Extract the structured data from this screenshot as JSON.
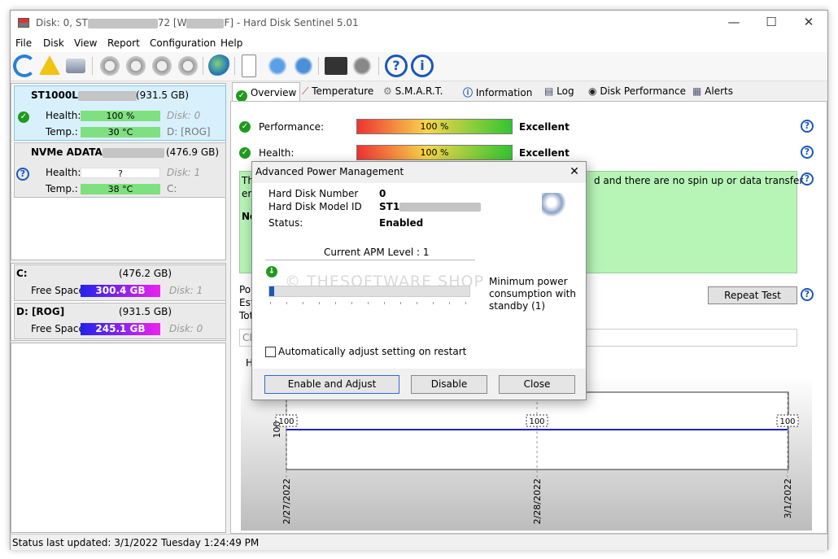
{
  "window": {
    "title_prefix": "Disk: 0, ST",
    "title_mid": "72 [W",
    "title_suffix": "F]  -  Hard Disk Sentinel 5.01",
    "minimize": "—",
    "maximize": "☐",
    "close": "✕"
  },
  "menu": [
    "File",
    "Disk",
    "View",
    "Report",
    "Configuration",
    "Help"
  ],
  "toolbar_icons": [
    "refresh-icon",
    "warning-icon",
    "drive-icon",
    "disk-test-icon",
    "disk-test-2-icon",
    "disk-ok-icon",
    "disk-tools-icon",
    "globe-icon",
    "report-icon",
    "sync-icon",
    "network-icon",
    "monitor-icon",
    "speaker-icon",
    "help-icon",
    "info-icon"
  ],
  "disks": [
    {
      "name": "ST1000L",
      "name_suffix": "(931.5 GB)",
      "health_label": "Health:",
      "health": "100 %",
      "health_part": "Disk: 0",
      "temp_label": "Temp.:",
      "temp": "30 °C",
      "temp_part": "D: [ROG]"
    },
    {
      "name": "NVMe   ADATA",
      "name_suffix": "(476.9 GB)",
      "health_label": "Health:",
      "health": "?",
      "health_part": "Disk: 1",
      "temp_label": "Temp.:",
      "temp": "38 °C",
      "temp_part": "C:"
    }
  ],
  "volumes": [
    {
      "name": "C:",
      "size": "(476.2 GB)",
      "free_label": "Free Space",
      "free": "300.4 GB",
      "disk": "Disk: 1"
    },
    {
      "name": "D: [ROG]",
      "size": "(931.5 GB)",
      "free_label": "Free Space",
      "free": "245.1 GB",
      "disk": "Disk: 0"
    }
  ],
  "tabs": [
    "Overview",
    "Temperature",
    "S.M.A.R.T.",
    "Information",
    "Log",
    "Disk Performance",
    "Alerts"
  ],
  "overview": {
    "performance_label": "Performance:",
    "performance_value": "100 %",
    "performance_text": "Excellent",
    "health_label": "Health:",
    "health_value": "100 %",
    "health_text": "Excellent",
    "status_text_a": "Th",
    "status_text_b": "d and there are no spin up or data transfer",
    "status_text_c": "er",
    "status_text_d": "No",
    "left_labels": [
      "Pow",
      "Est",
      "Tot"
    ],
    "repeat_test": "Repeat Test",
    "comment_placeholder": "Cli",
    "history_label": "H",
    "chart_values": [
      "100",
      "100",
      "100"
    ],
    "chart_dates": [
      "2/27/2022",
      "2/28/2022",
      "3/1/2022"
    ],
    "y_tick": "100"
  },
  "status_bar": "Status last updated: 3/1/2022 Tuesday 1:24:49 PM",
  "dialog": {
    "title": "Advanced Power Management",
    "close": "✕",
    "hdn_label": "Hard Disk Number",
    "hdn_value": "0",
    "model_label": "Hard Disk Model ID",
    "model_value": "ST1",
    "status_label": "Status:",
    "status_value": "Enabled",
    "apm_level": "Current APM Level : 1",
    "level_desc": "Minimum power consumption with standby (1)",
    "auto_adjust": "Automatically adjust setting on restart",
    "enable_btn": "Enable and Adjust",
    "disable_btn": "Disable",
    "close_btn": "Close",
    "watermark": "© THESOFTWARE SHOP"
  },
  "colors": {
    "accent": "#1b58b8",
    "health_green": "#6fe06f",
    "free_gradient_start": "#2222ee",
    "free_gradient_end": "#ee22ee",
    "status_box": "#b7f5b7"
  }
}
